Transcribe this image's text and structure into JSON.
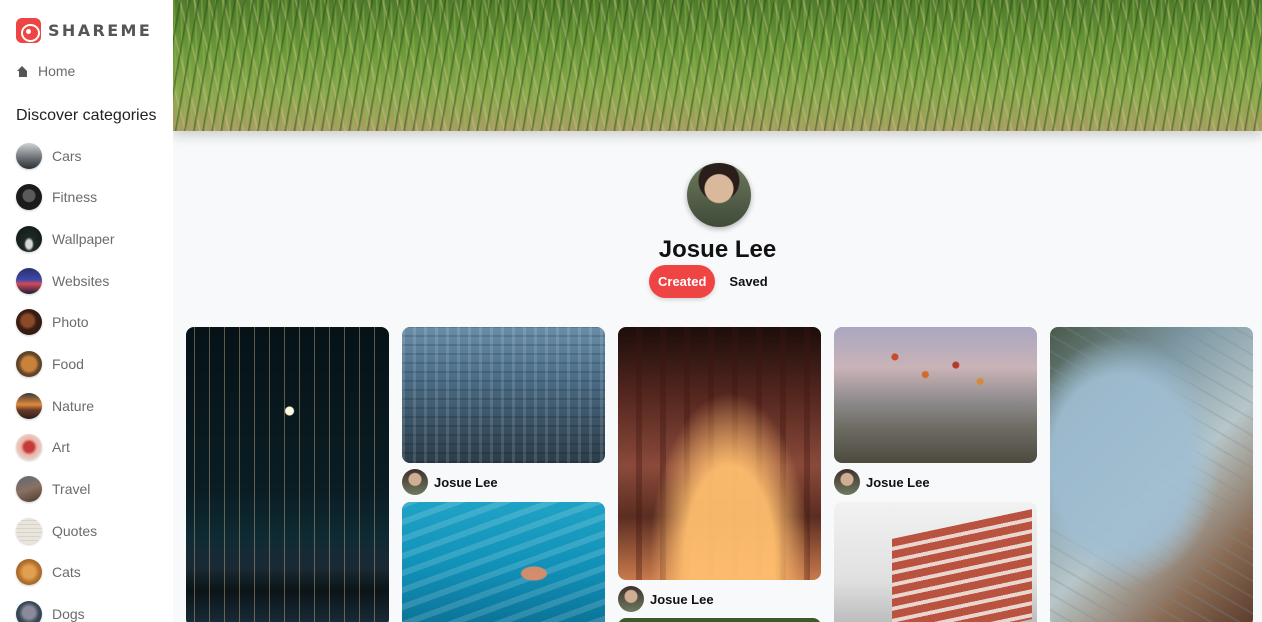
{
  "app": {
    "brand": "SHAREME",
    "accent_color": "#ef4444"
  },
  "sidebar": {
    "home_label": "Home",
    "categories_heading": "Discover categories",
    "categories": [
      {
        "label": "Cars"
      },
      {
        "label": "Fitness"
      },
      {
        "label": "Wallpaper"
      },
      {
        "label": "Websites"
      },
      {
        "label": "Photo"
      },
      {
        "label": "Food"
      },
      {
        "label": "Nature"
      },
      {
        "label": "Art"
      },
      {
        "label": "Travel"
      },
      {
        "label": "Quotes"
      },
      {
        "label": "Cats"
      },
      {
        "label": "Dogs"
      }
    ]
  },
  "profile": {
    "name": "Josue Lee",
    "tabs": {
      "created": "Created",
      "saved": "Saved"
    },
    "active_tab": "created"
  },
  "pins": [
    {
      "author": null
    },
    {
      "author": "Josue Lee"
    },
    {
      "author": null
    },
    {
      "author": "Josue Lee"
    },
    {
      "author": "Josue Lee"
    },
    {
      "author": null
    },
    {
      "author": null
    }
  ]
}
